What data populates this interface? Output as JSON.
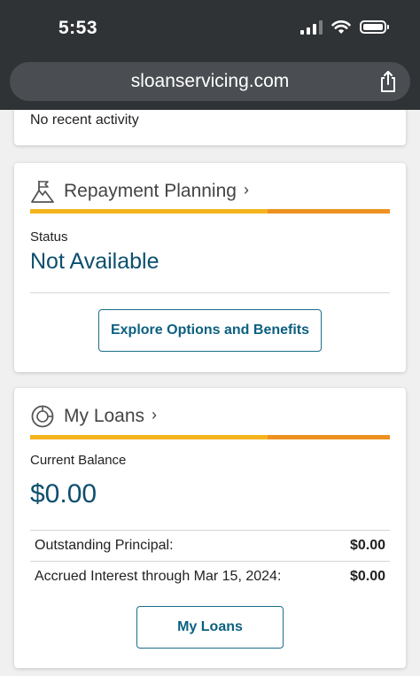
{
  "status_bar": {
    "time": "5:53"
  },
  "browser": {
    "url": "sloanservicing.com"
  },
  "recent_activity": {
    "text": "No recent activity"
  },
  "repayment": {
    "title": "Repayment Planning",
    "status_label": "Status",
    "status_value": "Not Available",
    "button_label": "Explore Options and Benefits"
  },
  "loans": {
    "title": "My Loans",
    "balance_label": "Current Balance",
    "balance_value": "$0.00",
    "rows": [
      {
        "label": "Outstanding Principal:",
        "value": "$0.00"
      },
      {
        "label": "Accrued Interest through Mar 15, 2024:",
        "value": "$0.00"
      }
    ],
    "button_label": "My Loans"
  },
  "colors": {
    "accent_yellow": "#f5b41e",
    "accent_orange": "#ee9121",
    "brand_teal": "#0c4f6e"
  }
}
